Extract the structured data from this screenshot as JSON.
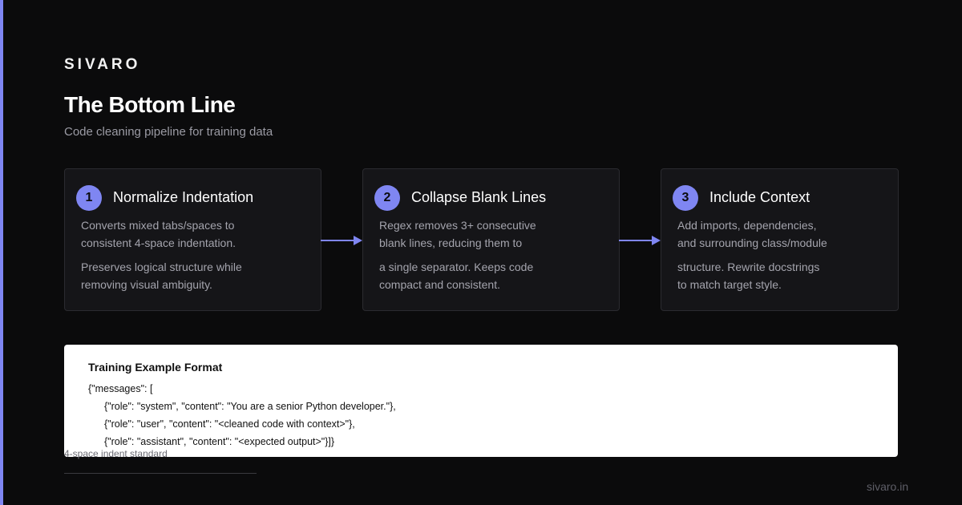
{
  "brand": "SIVARO",
  "header": {
    "title": "The Bottom Line",
    "subtitle": "Code cleaning pipeline for training data"
  },
  "steps": [
    {
      "number": "1",
      "title": "Normalize Indentation",
      "lines": [
        "Converts mixed tabs/spaces to",
        "consistent 4-space indentation.",
        "Preserves logical structure while",
        "removing visual ambiguity."
      ]
    },
    {
      "number": "2",
      "title": "Collapse Blank Lines",
      "lines": [
        "Regex removes 3+ consecutive",
        "blank lines, reducing them to",
        "a single separator. Keeps code",
        "compact and consistent."
      ]
    },
    {
      "number": "3",
      "title": "Include Context",
      "lines": [
        "Add imports, dependencies,",
        "and surrounding class/module",
        "structure. Rewrite docstrings",
        "to match target style."
      ]
    }
  ],
  "training_example": {
    "title": "Training Example Format",
    "lines": [
      "{\"messages\": [",
      "{\"role\": \"system\", \"content\": \"You are a senior Python developer.\"},",
      "{\"role\": \"user\", \"content\": \"<cleaned code with context>\"},",
      "{\"role\": \"assistant\", \"content\": \"<expected output>\"}]}"
    ]
  },
  "footer": {
    "note": "4-space indent standard",
    "site": "sivaro.in"
  },
  "colors": {
    "accent": "#7f86f2",
    "background": "#0b0b0c",
    "card": "#151518"
  }
}
